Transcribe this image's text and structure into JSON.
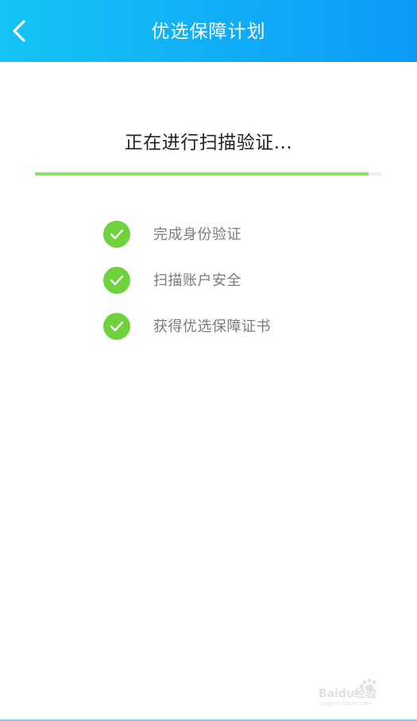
{
  "header": {
    "title": "优选保障计划",
    "back_icon": "chevron-left-icon",
    "color_start": "#14c4f5",
    "color_end": "#0d9af9"
  },
  "scan": {
    "title": "正在进行扫描验证...",
    "progress": 0.96,
    "progress_color": "#8fdc70"
  },
  "steps": [
    {
      "label": "完成身份验证",
      "icon": "check-circle-icon",
      "status": "done"
    },
    {
      "label": "扫描账户安全",
      "icon": "check-circle-icon",
      "status": "done"
    },
    {
      "label": "获得优选保障证书",
      "icon": "check-circle-icon",
      "status": "done"
    }
  ],
  "check_color": "#6fd23c",
  "watermark": {
    "brand": "Baidu经验",
    "url": "jingyan.baidu.com"
  }
}
